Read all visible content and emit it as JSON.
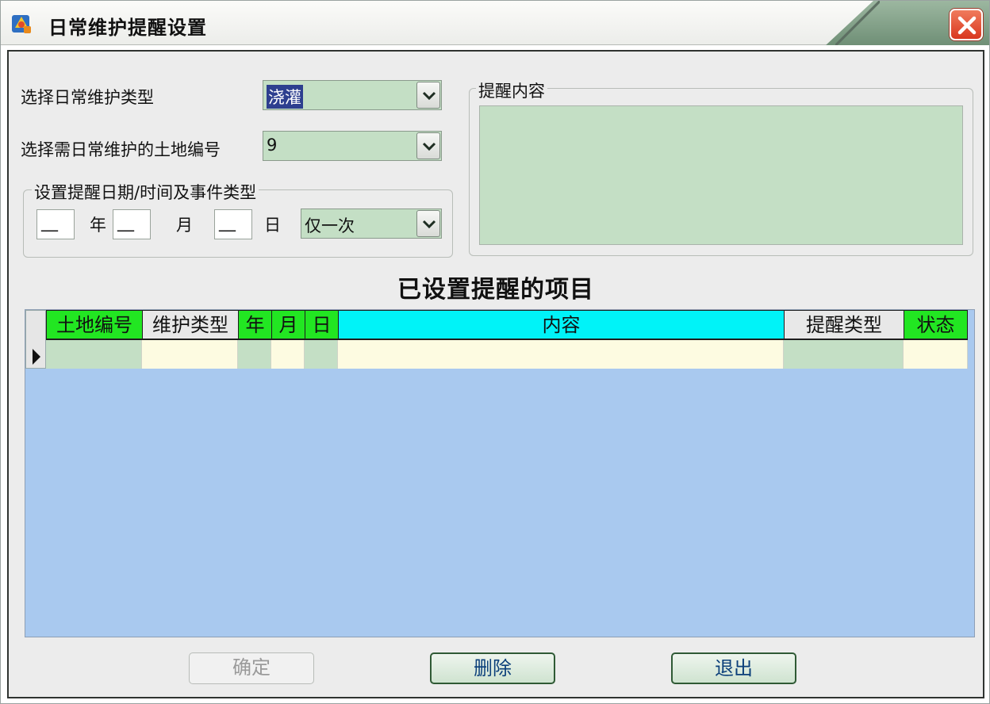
{
  "window": {
    "title": "日常维护提醒设置"
  },
  "form": {
    "type_label": "选择日常维护类型",
    "type_value": "浇灌",
    "land_label": "选择需日常维护的土地编号",
    "land_value": "9",
    "date_group_caption": "设置提醒日期/时间及事件类型",
    "year_value": "__",
    "year_label": "年",
    "month_value": "__",
    "month_label": "月",
    "day_value": "__",
    "day_label": "日",
    "repeat_value": "仅一次",
    "content_caption": "提醒内容"
  },
  "table": {
    "heading": "已设置提醒的项目",
    "columns": [
      "土地编号",
      "维护类型",
      "年",
      "月",
      "日",
      "内容",
      "提醒类型",
      "状态"
    ]
  },
  "buttons": {
    "ok": "确定",
    "delete": "删除",
    "exit": "退出"
  },
  "colors": {
    "field_green": "#c4dfc5",
    "header_green": "#22e622",
    "header_cyan": "#00f3f8",
    "grid_blue": "#a9c9ef",
    "row_cream": "#fdfbe1"
  },
  "icons": [
    "app-icon",
    "close-icon",
    "chevron-down-icon",
    "row-pointer-icon"
  ]
}
